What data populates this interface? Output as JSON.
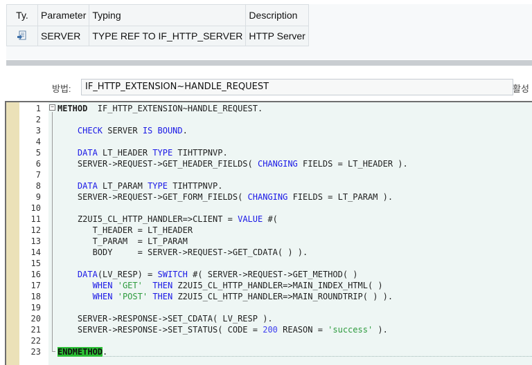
{
  "params": {
    "headers": {
      "ty": "Ty.",
      "parameter": "Parameter",
      "typing": "Typing",
      "description": "Description"
    },
    "rows": [
      {
        "icon": "import-parameter-icon",
        "parameter": "SERVER",
        "typing": "TYPE REF TO IF_HTTP_SERVER",
        "description": "HTTP Server"
      }
    ]
  },
  "method": {
    "label": "방법:",
    "value": "IF_HTTP_EXTENSION~HANDLE_REQUEST",
    "status_label": "활성"
  },
  "editor": {
    "colors": {
      "keyword": "#1a18e6",
      "string": "#2e9b3e",
      "number": "#3e3ef0",
      "endmethod_highlight": "#2bbf35"
    },
    "lines": [
      {
        "n": "1",
        "t": [
          [
            "kwb",
            "METHOD"
          ],
          [
            "",
            "  IF_HTTP_EXTENSION~HANDLE_REQUEST."
          ]
        ]
      },
      {
        "n": "2",
        "t": []
      },
      {
        "n": "3",
        "t": [
          [
            "",
            "    "
          ],
          [
            "kw",
            "CHECK"
          ],
          [
            "",
            " SERVER "
          ],
          [
            "kw",
            "IS BOUND"
          ],
          [
            "",
            "."
          ]
        ]
      },
      {
        "n": "4",
        "t": []
      },
      {
        "n": "5",
        "t": [
          [
            "",
            "    "
          ],
          [
            "kw",
            "DATA"
          ],
          [
            "",
            " LT_HEADER "
          ],
          [
            "kw",
            "TYPE"
          ],
          [
            "",
            " TIHTTPNVP."
          ]
        ]
      },
      {
        "n": "6",
        "t": [
          [
            "",
            "    SERVER->REQUEST->GET_HEADER_FIELDS( "
          ],
          [
            "kw",
            "CHANGING"
          ],
          [
            "",
            " FIELDS = LT_HEADER )."
          ]
        ]
      },
      {
        "n": "7",
        "t": []
      },
      {
        "n": "8",
        "t": [
          [
            "",
            "    "
          ],
          [
            "kw",
            "DATA"
          ],
          [
            "",
            " LT_PARAM "
          ],
          [
            "kw",
            "TYPE"
          ],
          [
            "",
            " TIHTTPNVP."
          ]
        ]
      },
      {
        "n": "9",
        "t": [
          [
            "",
            "    SERVER->REQUEST->GET_FORM_FIELDS( "
          ],
          [
            "kw",
            "CHANGING"
          ],
          [
            "",
            " FIELDS = LT_PARAM )."
          ]
        ]
      },
      {
        "n": "10",
        "t": []
      },
      {
        "n": "11",
        "t": [
          [
            "",
            "    Z2UI5_CL_HTTP_HANDLER=>CLIENT = "
          ],
          [
            "kw",
            "VALUE"
          ],
          [
            "",
            " #("
          ]
        ]
      },
      {
        "n": "12",
        "t": [
          [
            "",
            "       T_HEADER = LT_HEADER"
          ]
        ]
      },
      {
        "n": "13",
        "t": [
          [
            "",
            "       T_PARAM  = LT_PARAM"
          ]
        ]
      },
      {
        "n": "14",
        "t": [
          [
            "",
            "       BODY     = SERVER->REQUEST->GET_CDATA( ) )."
          ]
        ]
      },
      {
        "n": "15",
        "t": []
      },
      {
        "n": "16",
        "t": [
          [
            "",
            "    "
          ],
          [
            "kw",
            "DATA"
          ],
          [
            "",
            "(LV_RESP) = "
          ],
          [
            "kw",
            "SWITCH"
          ],
          [
            "",
            " #( SERVER->REQUEST->GET_METHOD( )"
          ]
        ]
      },
      {
        "n": "17",
        "t": [
          [
            "",
            "       "
          ],
          [
            "kw",
            "WHEN"
          ],
          [
            "",
            " "
          ],
          [
            "str",
            "'GET'"
          ],
          [
            "",
            "  "
          ],
          [
            "kw",
            "THEN"
          ],
          [
            "",
            " Z2UI5_CL_HTTP_HANDLER=>MAIN_INDEX_HTML( )"
          ]
        ]
      },
      {
        "n": "18",
        "t": [
          [
            "",
            "       "
          ],
          [
            "kw",
            "WHEN"
          ],
          [
            "",
            " "
          ],
          [
            "str",
            "'POST'"
          ],
          [
            "",
            " "
          ],
          [
            "kw",
            "THEN"
          ],
          [
            "",
            " Z2UI5_CL_HTTP_HANDLER=>MAIN_ROUNDTRIP( ) )."
          ]
        ]
      },
      {
        "n": "19",
        "t": []
      },
      {
        "n": "20",
        "t": [
          [
            "",
            "    SERVER->RESPONSE->SET_CDATA( LV_RESP )."
          ]
        ]
      },
      {
        "n": "21",
        "t": [
          [
            "",
            "    SERVER->RESPONSE->SET_STATUS( CODE = "
          ],
          [
            "num",
            "200"
          ],
          [
            "",
            " REASON = "
          ],
          [
            "str",
            "'success'"
          ],
          [
            "",
            " )."
          ]
        ]
      },
      {
        "n": "22",
        "t": []
      },
      {
        "n": "23",
        "t": [
          [
            "endm",
            "ENDMETHOD"
          ],
          [
            "",
            "."
          ]
        ]
      }
    ]
  }
}
